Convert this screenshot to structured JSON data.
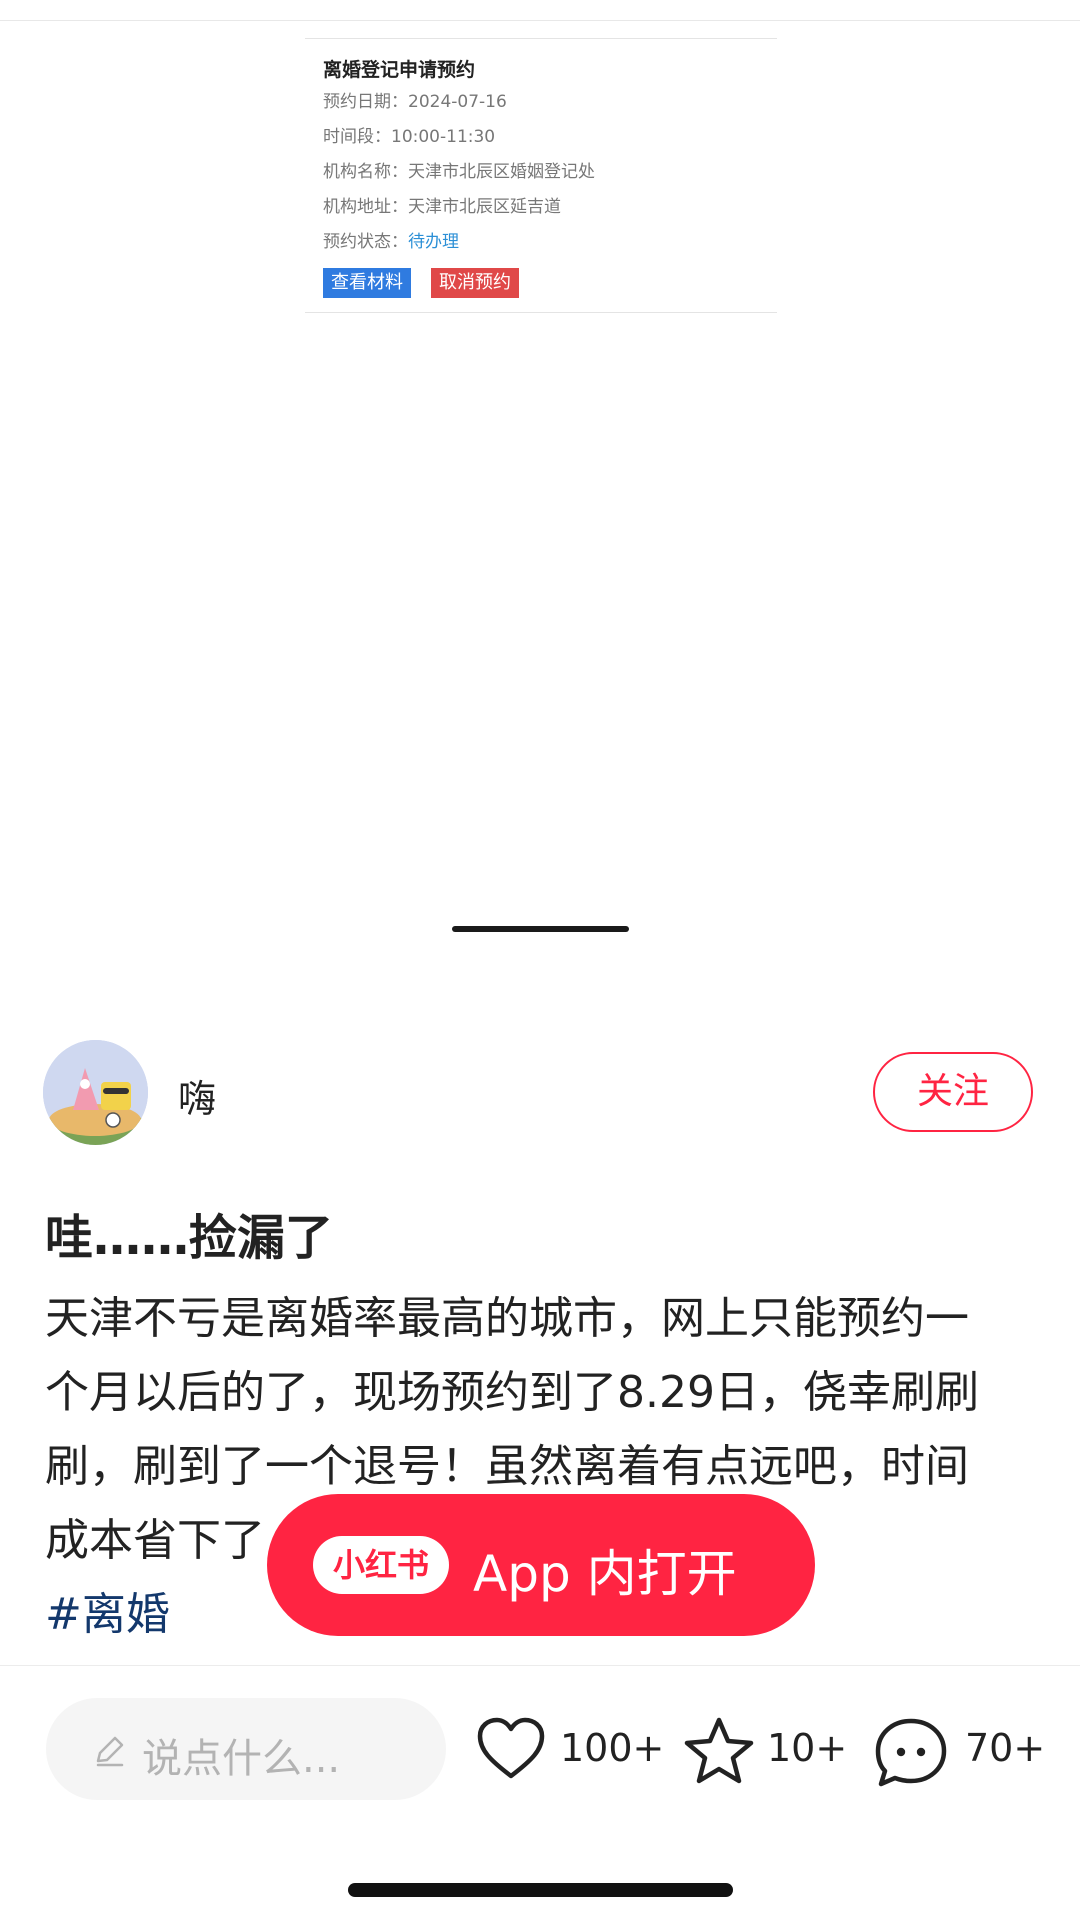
{
  "screenshot": {
    "title": "离婚登记申请预约",
    "rows": [
      {
        "label": "预约日期：",
        "value": "2024-07-16"
      },
      {
        "label": "时间段：",
        "value": "10:00-11:30"
      },
      {
        "label": "机构名称：",
        "value": "天津市北辰区婚姻登记处"
      },
      {
        "label": "机构地址：",
        "value": "天津市北辰区延吉道"
      },
      {
        "label": "预约状态：",
        "value": "待办理"
      }
    ],
    "view_button": "查看材料",
    "cancel_button": "取消预约"
  },
  "author": {
    "name": "嗨",
    "follow_label": "关注"
  },
  "post": {
    "title": "哇……捡漏了",
    "body_lines": [
      "天津不亏是离婚率最高的城市，网上只能预约一",
      "个月以后的了，现场预约到了8.29日，侥幸刷刷",
      "刷，刷到了一个退号！虽然离着有点远吧，时间",
      "成本省下了"
    ],
    "hashtag": "#离婚"
  },
  "open_app": {
    "logo": "小红书",
    "label": "App 内打开"
  },
  "bottom_bar": {
    "comment_placeholder": "说点什么...",
    "likes": "100+",
    "favorites": "10+",
    "comments": "70+"
  },
  "colors": {
    "brand_red": "#ff2442",
    "hashtag_blue": "#13386c",
    "status_blue": "#2b8fd6",
    "view_button_blue": "#2f7be0",
    "cancel_button_red": "#e04848"
  },
  "icons": [
    "pencil-icon",
    "heart-icon",
    "star-icon",
    "comment-icon"
  ]
}
